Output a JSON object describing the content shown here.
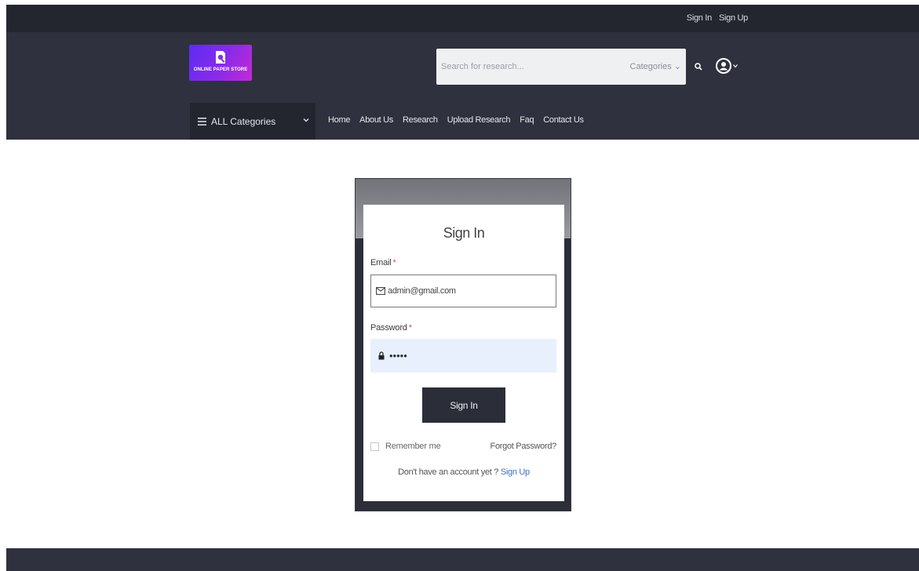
{
  "topbar": {
    "signin_label": "Sign In",
    "signup_label": "Sign Up"
  },
  "header": {
    "logo_text": "ONLINE PAPER STORE",
    "search": {
      "placeholder": "Search for research...",
      "category_label": "Categories"
    },
    "categories_button": "ALL Categories",
    "nav": [
      "Home",
      "About Us",
      "Research",
      "Upload Research",
      "Faq",
      "Contact Us"
    ]
  },
  "form": {
    "title": "Sign In",
    "email_label": "Email",
    "email_value": "admin@gmail.com",
    "password_label": "Password",
    "password_value": "•••••",
    "required_mark": "*",
    "submit_label": "Sign In",
    "remember_label": "Remember me",
    "forgot_label": "Forgot Password?",
    "no_account_text": "Don't have an account yet ?",
    "signup_link": "Sign Up"
  },
  "colors": {
    "header_bg": "#2f313e",
    "topbar_bg": "#23262f",
    "logo_gradient_start": "#5b2cf5",
    "logo_gradient_end": "#c42ad6",
    "link": "#3b6fc4",
    "required": "#e44"
  },
  "icons": {
    "search": "search-icon",
    "user": "user-circle-icon",
    "menu": "hamburger-icon",
    "email": "envelope-icon",
    "password": "lock-icon"
  }
}
